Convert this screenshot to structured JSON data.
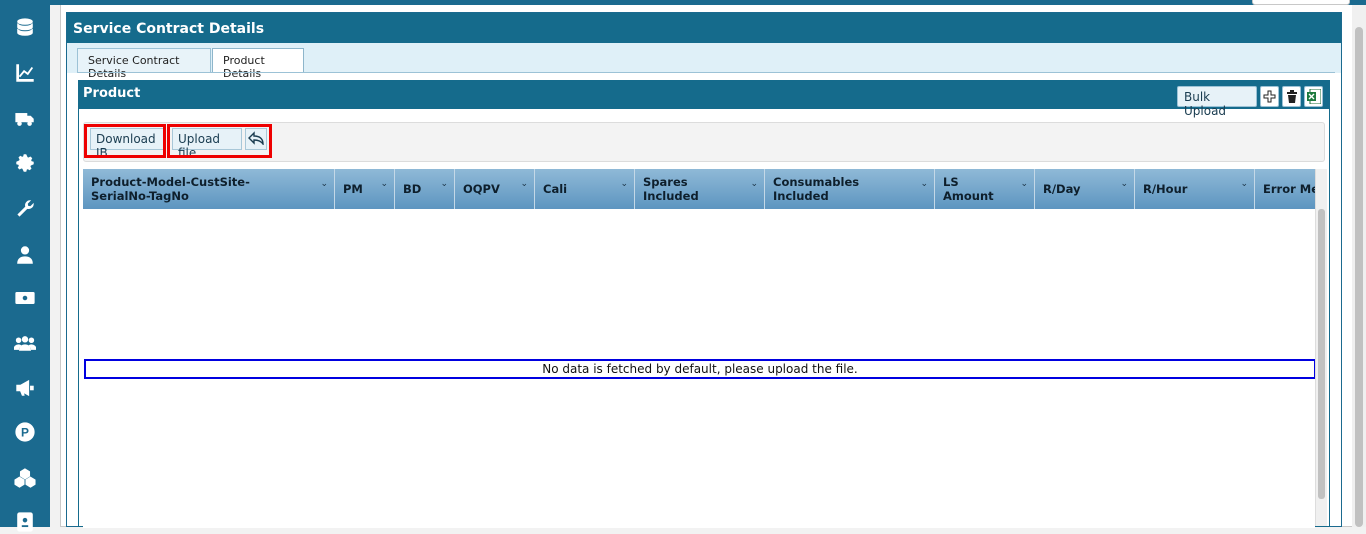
{
  "colors": {
    "accent": "#156b8c",
    "sidebar": "#1b6a8f",
    "highlight_red": "#e00000",
    "highlight_blue": "#0000e0"
  },
  "sidebar": {
    "icons": [
      "database-icon",
      "chart-line-icon",
      "truck-icon",
      "gear-icon",
      "wrench-icon",
      "user-icon",
      "money-icon",
      "users-icon",
      "megaphone-icon",
      "parking-icon",
      "cubes-icon",
      "id-card-icon"
    ]
  },
  "panel": {
    "title": "Service Contract Details"
  },
  "tabs": [
    {
      "label": "Service Contract Details",
      "active": false
    },
    {
      "label": "Product Details",
      "active": true
    }
  ],
  "product": {
    "title": "Product",
    "bulk_upload_label": "Bulk Upload",
    "toolbar": {
      "download_label": "Download IB",
      "upload_label": "Upload file"
    },
    "columns": [
      "Product-Model-CustSite-\nSerialNo-TagNo",
      "PM",
      "BD",
      "OQPV",
      "Cali",
      "Spares\nIncluded",
      "Consumables\nIncluded",
      "LS\nAmount",
      "R/Day",
      "R/Hour",
      "Error Messa"
    ],
    "empty_message": "No data is fetched by default, please upload the file."
  }
}
